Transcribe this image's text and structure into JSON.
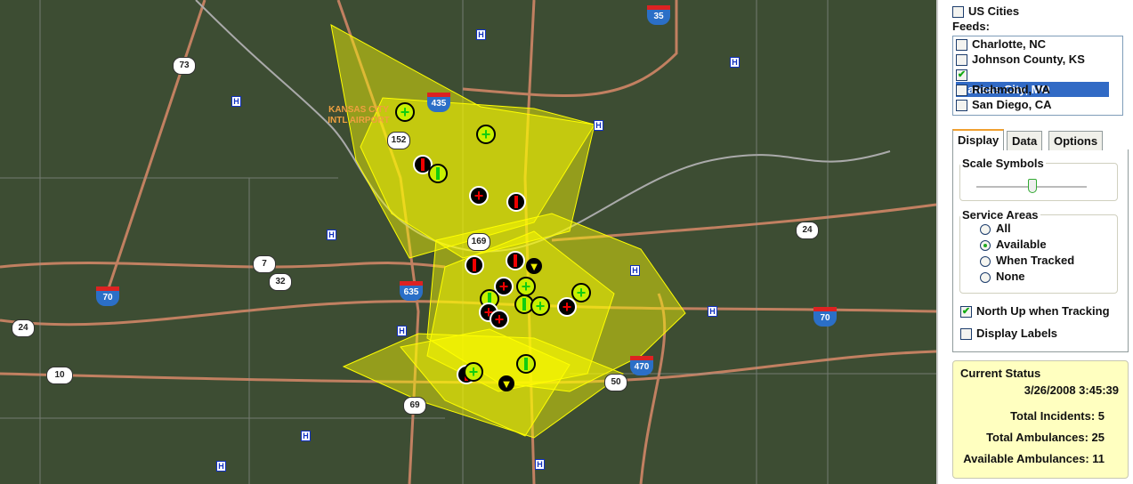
{
  "map": {
    "airport_label": "KANSAS CITY INTL AIRPORT",
    "hospital_icon_text": "H",
    "interstate_shields": [
      "35",
      "435",
      "635",
      "70",
      "70",
      "470"
    ],
    "us_shields": [
      "73",
      "152",
      "169",
      "7",
      "32",
      "24",
      "24",
      "10",
      "69",
      "50"
    ],
    "colors": {
      "service_area": "#ffff00",
      "incident": "#e00000",
      "available": "#22cc22",
      "satellite": "#3d4d33"
    }
  },
  "panel": {
    "us_cities": {
      "label": "US Cities",
      "checked": false
    },
    "feeds_label": "Feeds:",
    "feeds": [
      {
        "label": "Charlotte, NC",
        "checked": false
      },
      {
        "label": "Johnson County, KS",
        "checked": false
      },
      {
        "label": "Kansas City, MO",
        "checked": true,
        "selected": true
      },
      {
        "label": "Richmond, VA",
        "checked": false
      },
      {
        "label": "San Diego, CA",
        "checked": false
      }
    ],
    "tabs": [
      "Display",
      "Data",
      "Options"
    ],
    "active_tab": "Display",
    "scale_symbols": {
      "label": "Scale Symbols",
      "value_fraction": 0.5
    },
    "service_areas": {
      "label": "Service Areas",
      "options": [
        "All",
        "Available",
        "When Tracked",
        "None"
      ],
      "selected": "Available"
    },
    "north_up": {
      "label": "North Up when Tracking",
      "checked": true
    },
    "display_labels": {
      "label": "Display Labels",
      "checked": false
    },
    "status": {
      "title": "Current Status",
      "timestamp": "3/26/2008 3:45:39",
      "total_incidents": "Total Incidents: 5",
      "total_ambulances": "Total Ambulances: 25",
      "available_ambulances": "Available Ambulances: 11"
    }
  }
}
